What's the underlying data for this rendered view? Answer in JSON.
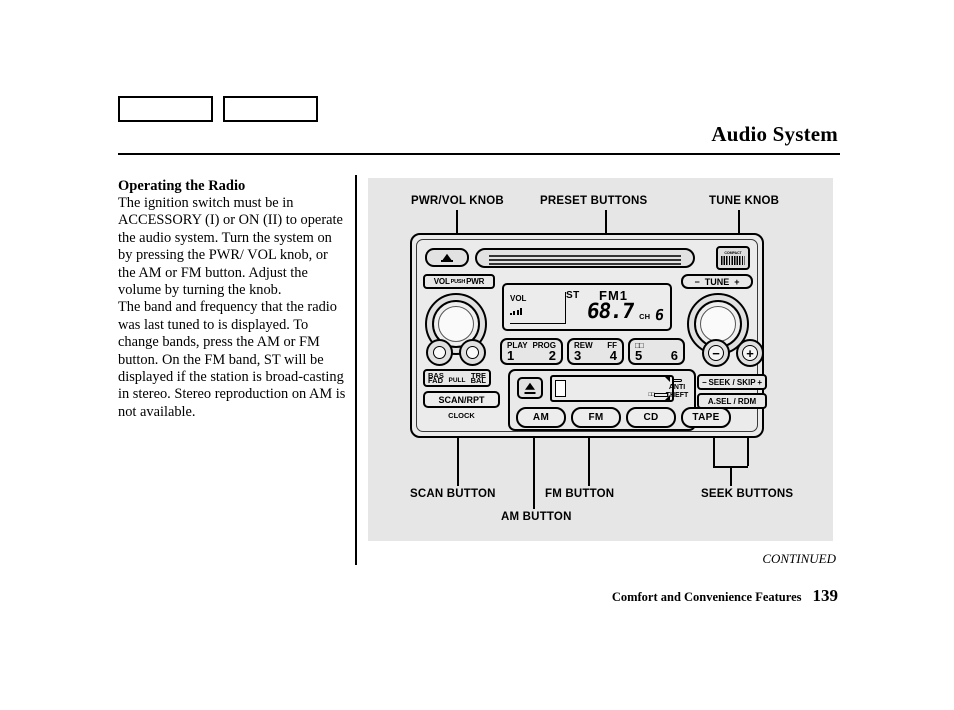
{
  "header": {
    "title": "Audio System",
    "tabs": [
      "",
      ""
    ]
  },
  "article": {
    "heading": "Operating the Radio",
    "paragraph1": "The ignition switch must be in ACCESSORY (I) or ON (II) to operate the audio system. Turn the system on by pressing the PWR/ VOL knob, or the AM or FM button. Adjust the volume by turning the knob.",
    "paragraph2": "The band and frequency that the radio was last tuned to is displayed. To change bands, press the AM or FM button. On the FM band, ST will be displayed if the station is broad-casting in stereo. Stereo reproduction on AM is not available."
  },
  "figure": {
    "callouts": {
      "pwr_vol_knob": "PWR/VOL KNOB",
      "preset_buttons": "PRESET BUTTONS",
      "tune_knob": "TUNE KNOB",
      "scan_button": "SCAN BUTTON",
      "am_button": "AM BUTTON",
      "fm_button": "FM BUTTON",
      "seek_buttons": "SEEK BUTTONS"
    },
    "radio": {
      "vol_pwr_label": {
        "left": "VOL",
        "mid": "PUSH",
        "right": "PWR"
      },
      "tune_label": {
        "minus": "−",
        "text": "TUNE",
        "plus": "+"
      },
      "cd_logo": {
        "top": "COMPACT",
        "bottom": "DIGITAL AUDIO"
      },
      "display": {
        "vol_text": "VOL",
        "stereo_indicator": "ST",
        "band": "FM1",
        "frequency": "68.7",
        "channel_label": "CH",
        "channel_number": "6"
      },
      "presets": [
        {
          "top_left": "PLAY",
          "top_right": "PROG",
          "num_left": "1",
          "num_right": "2"
        },
        {
          "top_left": "REW",
          "top_right": "FF",
          "num_left": "3",
          "num_right": "4"
        },
        {
          "top_left": "□□",
          "top_right": "",
          "num_left": "5",
          "num_right": "6"
        }
      ],
      "tone_label": {
        "bas": "BAS",
        "tre": "TRE",
        "fad": "FAD",
        "bal": "BAL",
        "pull": "PULL"
      },
      "scan_button": "SCAN/RPT",
      "clock_label": "CLOCK",
      "anti_theft": {
        "line1": "ANTI",
        "line2": "THEFT"
      },
      "source_buttons": [
        "AM",
        "FM",
        "CD",
        "TAPE"
      ],
      "seek_minus": "−",
      "seek_plus": "+",
      "seek_label": {
        "minus": "−",
        "text": "SEEK / SKIP",
        "plus": "+"
      },
      "asel_label": "A.SEL / RDM"
    }
  },
  "footer": {
    "continued": "CONTINUED",
    "section": "Comfort and Convenience Features",
    "page_number": "139"
  },
  "colors": {
    "panel_bg": "#e6e6e6",
    "page_bg": "#ffffff",
    "ink": "#000000"
  }
}
